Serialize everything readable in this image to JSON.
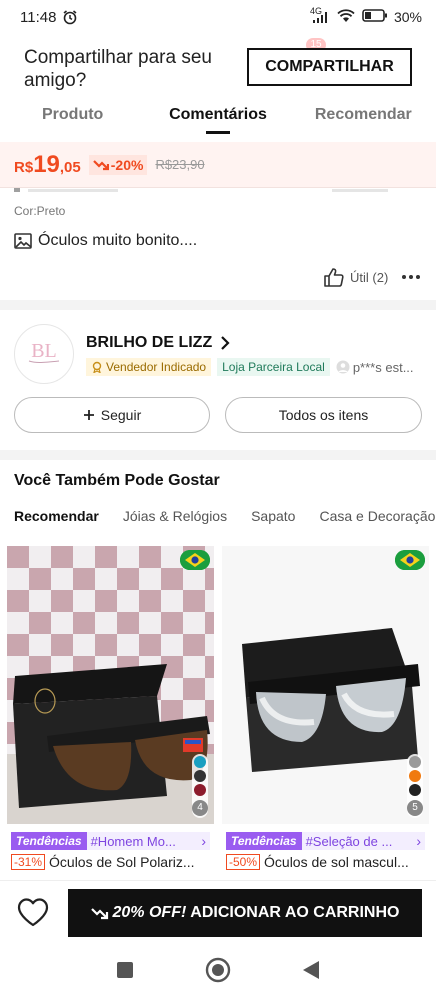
{
  "status_bar": {
    "time": "11:48",
    "network": "4G",
    "battery": "30%",
    "icons": [
      "alarm-icon",
      "signal-icon",
      "wifi-icon",
      "battery-icon"
    ]
  },
  "header": {
    "share_prompt": "Compartilhar para seu amigo?",
    "share_button": "COMPARTILHAR"
  },
  "tabs": [
    {
      "label": "Produto",
      "active": false
    },
    {
      "label": "Comentários",
      "active": true
    },
    {
      "label": "Recomendar",
      "active": false
    }
  ],
  "price": {
    "currency": "R$",
    "integer": "19",
    "decimal": ",05",
    "discount": "-20%",
    "original": "R$23,90",
    "accent_color": "#f04a20"
  },
  "review": {
    "color_label": "Cor:Preto",
    "text": "Óculos muito bonito....",
    "helpful_label": "Útil (2)"
  },
  "store": {
    "logo_text": "BL",
    "name": "BRILHO DE LIZZ",
    "seller_badge": "Vendedor Indicado",
    "local_badge": "Loja Parceira Local",
    "user_text": "p***s est...",
    "follow_label": "Seguir",
    "all_items_label": "Todos os itens"
  },
  "recommendations": {
    "title": "Você Também Pode Gostar",
    "tabs": [
      {
        "label": "Recomendar",
        "active": true
      },
      {
        "label": "Jóias & Relógios",
        "active": false
      },
      {
        "label": "Sapato",
        "active": false
      },
      {
        "label": "Casa e Decoração",
        "active": false
      }
    ],
    "products": [
      {
        "trend_tag": "Tendências",
        "trend_text": "#Homem Mo...",
        "discount": "-31%",
        "name": "Óculos de Sol Polariz...",
        "color_count": "4",
        "colors": [
          "#1a9fc0",
          "#333333",
          "#8c1c2c"
        ]
      },
      {
        "trend_tag": "Tendências",
        "trend_text": "#Seleção de ...",
        "discount": "-50%",
        "name": "Óculos de sol mascul...",
        "color_count": "5",
        "colors": [
          "#9a9a9a",
          "#f07a10",
          "#222222"
        ]
      }
    ]
  },
  "bottom_bar": {
    "promo": "20% OFF!",
    "add_to_cart": "ADICIONAR AO CARRINHO"
  }
}
